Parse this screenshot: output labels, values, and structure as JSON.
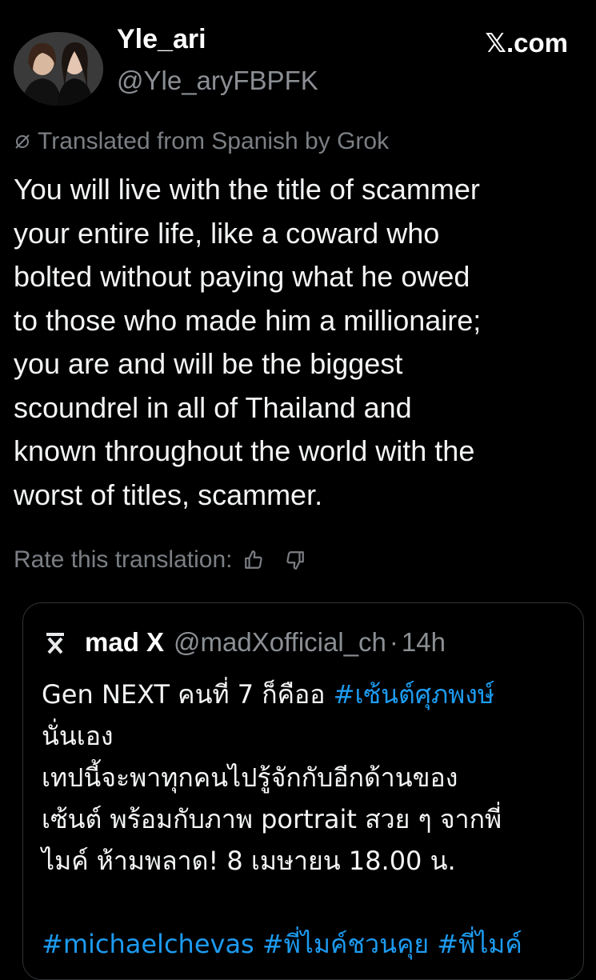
{
  "header": {
    "display_name": "Yle_ari",
    "handle": "@Yle_aryFBPFK",
    "site": "𝕏.com"
  },
  "translation": {
    "label": "Translated from Spanish by Grok",
    "rate_label": "Rate this translation:"
  },
  "tweet": {
    "lines": [
      "You will live with the title of scammer",
      "your entire life, like a coward who",
      "bolted without paying what he owed",
      "to those who made him a millionaire;",
      "you are and will be the biggest",
      "scoundrel in all of Thailand and",
      "known throughout the world with the",
      "worst of titles, scammer."
    ]
  },
  "quote": {
    "name": "mad X",
    "handle": "@madXofficial_ch",
    "separator": "·",
    "time": "14h",
    "line1_text": "Gen NEXT คนที่ 7 ก็คืออ ",
    "line1_hashtag": "#เซ้นต์ศุภพงษ์",
    "line2": "นั่นเอง",
    "line3": "เทปนี้จะพาทุกคนไปรู้จักกับอีกด้านของ",
    "line4": "เซ้นต์ พร้อมกับภาพ portrait สวย ๆ จากพี่",
    "line5": "ไมค์ ห้ามพลาด! 8 เมษายน 18.00 น.",
    "hashtags_line": "#michaelchevas #พี่ไมค์ชวนคุย #พี่ไมค์"
  },
  "colors": {
    "background": "#000000",
    "text": "#f3f4f5",
    "muted": "#7b7f84",
    "link": "#1d9bf0",
    "border": "#2f3336"
  }
}
